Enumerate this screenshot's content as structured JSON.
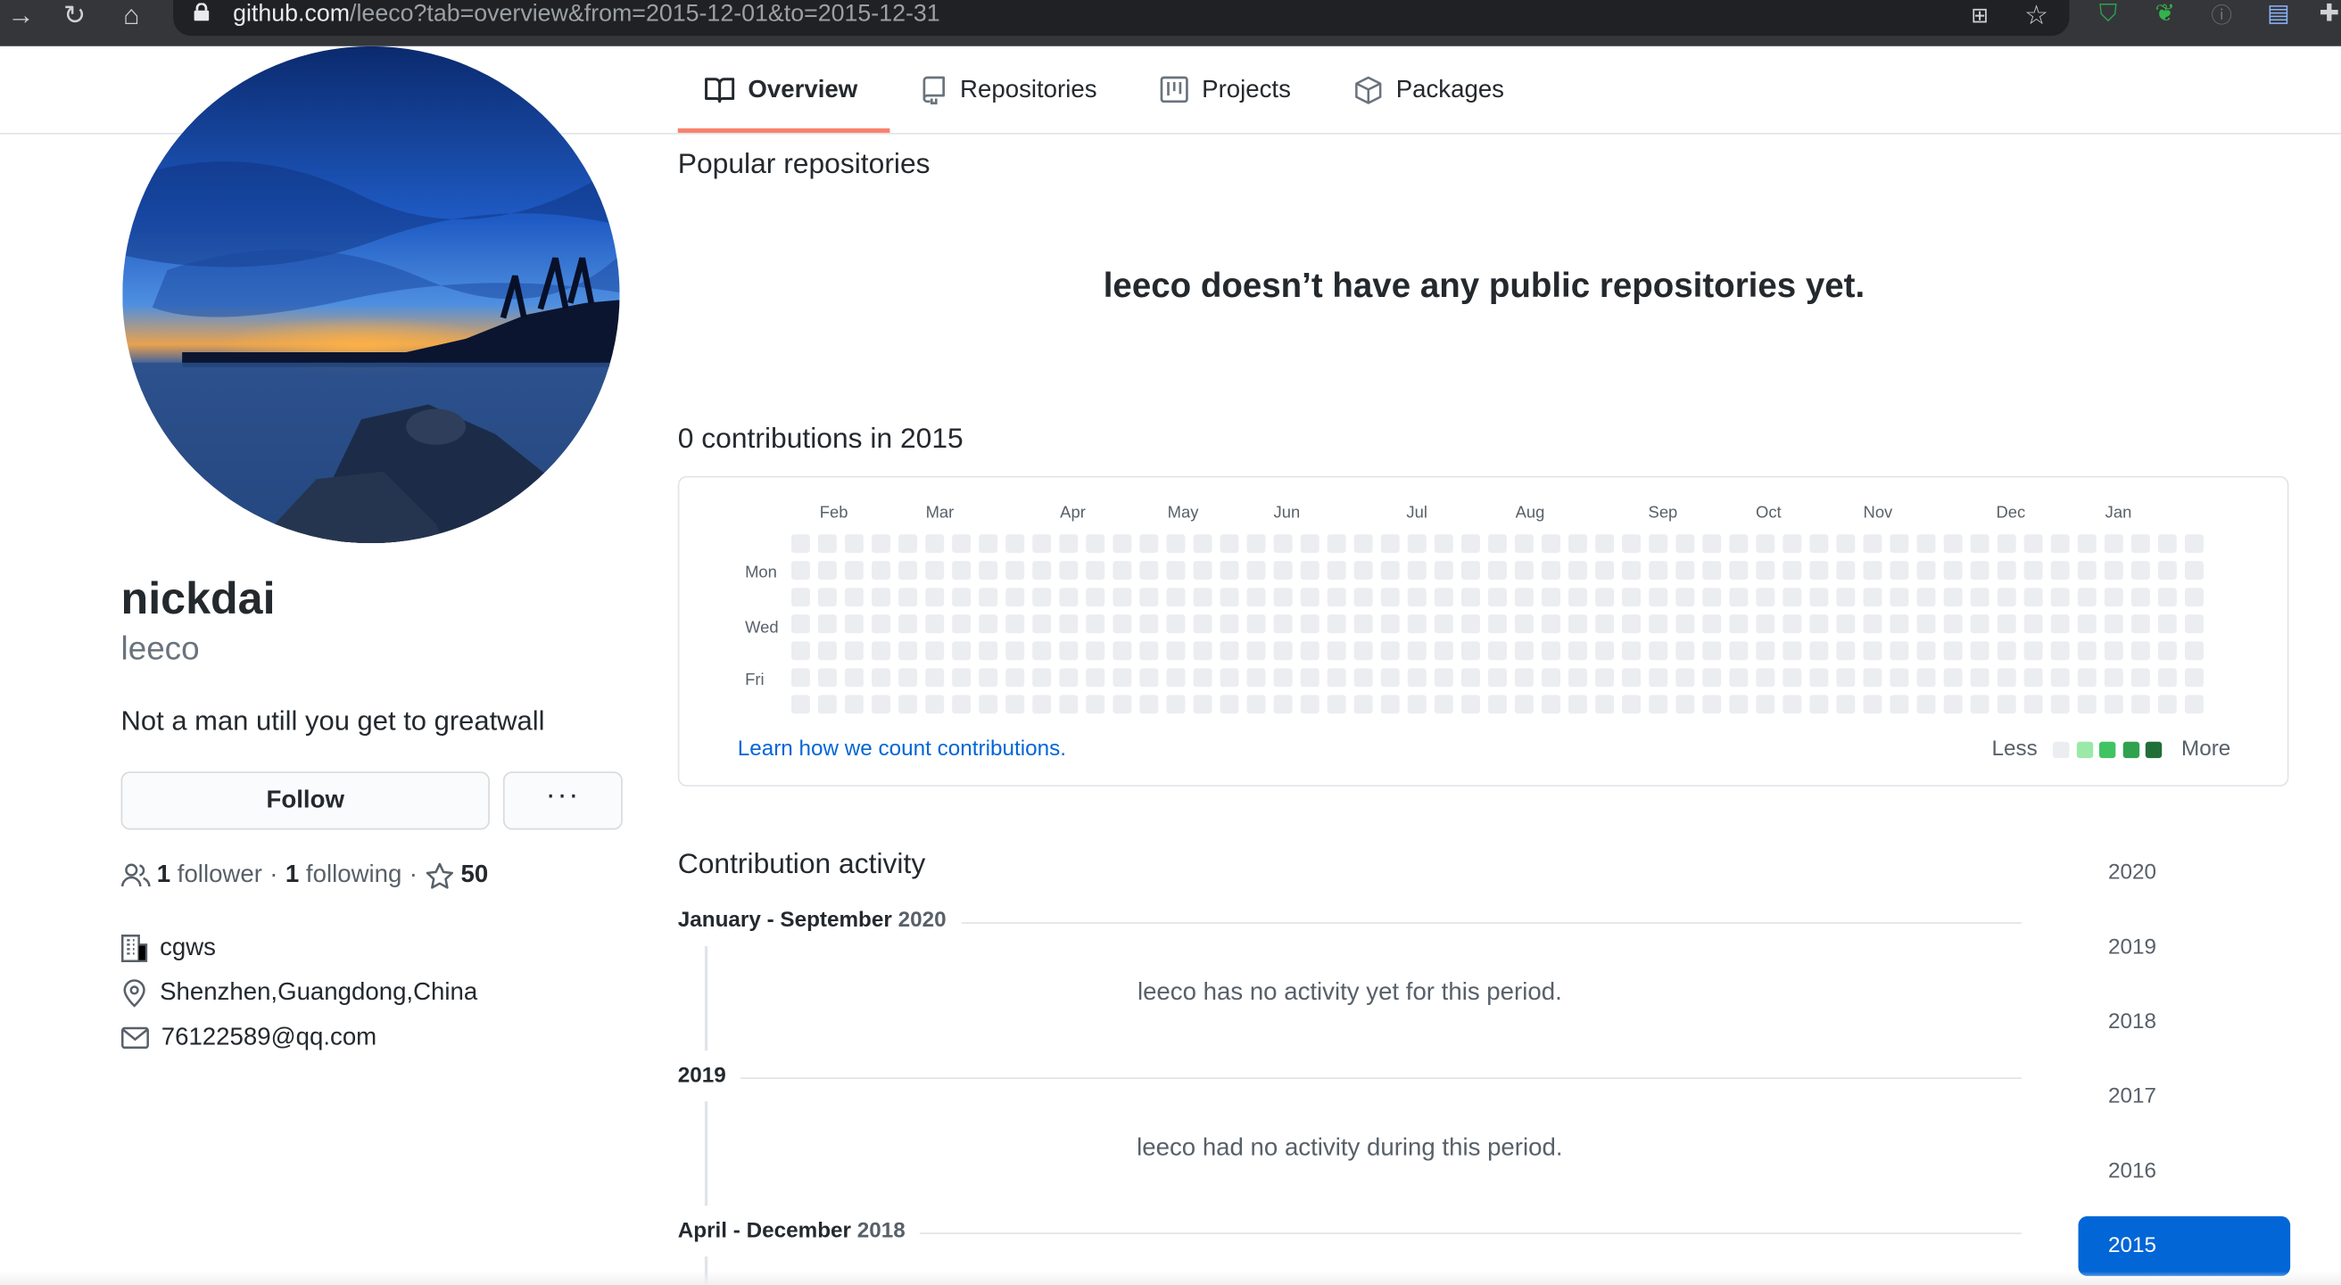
{
  "browser": {
    "url_host": "github.com",
    "url_path": "/leeco?tab=overview&from=2015-12-01&to=2015-12-31"
  },
  "tabs": [
    {
      "label": "Overview",
      "icon": "book-icon",
      "selected": true
    },
    {
      "label": "Repositories",
      "icon": "repo-icon"
    },
    {
      "label": "Projects",
      "icon": "project-icon"
    },
    {
      "label": "Packages",
      "icon": "package-icon"
    }
  ],
  "profile": {
    "full_name": "nickdai",
    "login": "leeco",
    "bio": "Not a man utill you get to greatwall",
    "follow_label": "Follow",
    "more_label": "···",
    "followers_count": "1",
    "followers_label": "follower",
    "following_count": "1",
    "following_label": "following",
    "separator": "·",
    "stars_count": "50",
    "company": "cgws",
    "location": "Shenzhen,Guangdong,China",
    "email": "76122589@qq.com"
  },
  "main": {
    "popular_title": "Popular repositories",
    "blank_message": "leeco doesn’t have any public repositories yet.",
    "contrib_title": "0 contributions in 2015",
    "months": [
      "Feb",
      "Mar",
      "Apr",
      "May",
      "Jun",
      "Jul",
      "Aug",
      "Sep",
      "Oct",
      "Nov",
      "Dec",
      "Jan"
    ],
    "days": [
      "Mon",
      "Wed",
      "Fri"
    ],
    "learn_link": "Learn how we count contributions.",
    "legend_less": "Less",
    "legend_more": "More",
    "legend_colors": [
      "#ebedf0",
      "#9be9a8",
      "#40c463",
      "#30a14e",
      "#216e39"
    ],
    "empty_cell_color": "#ebedf0",
    "total_contributions": 0
  },
  "activity": {
    "title": "Contribution activity",
    "periods": [
      {
        "label": "January - September",
        "year": "2020",
        "message": "leeco has no activity yet for this period."
      },
      {
        "label": "2019",
        "year": "",
        "message": "leeco had no activity during this period."
      },
      {
        "label": "April - December",
        "year": "2018",
        "message": ""
      }
    ],
    "years": [
      "2020",
      "2019",
      "2018",
      "2017",
      "2016",
      "2015"
    ],
    "selected_year": "2015",
    "accent_color": "#0366d6"
  }
}
